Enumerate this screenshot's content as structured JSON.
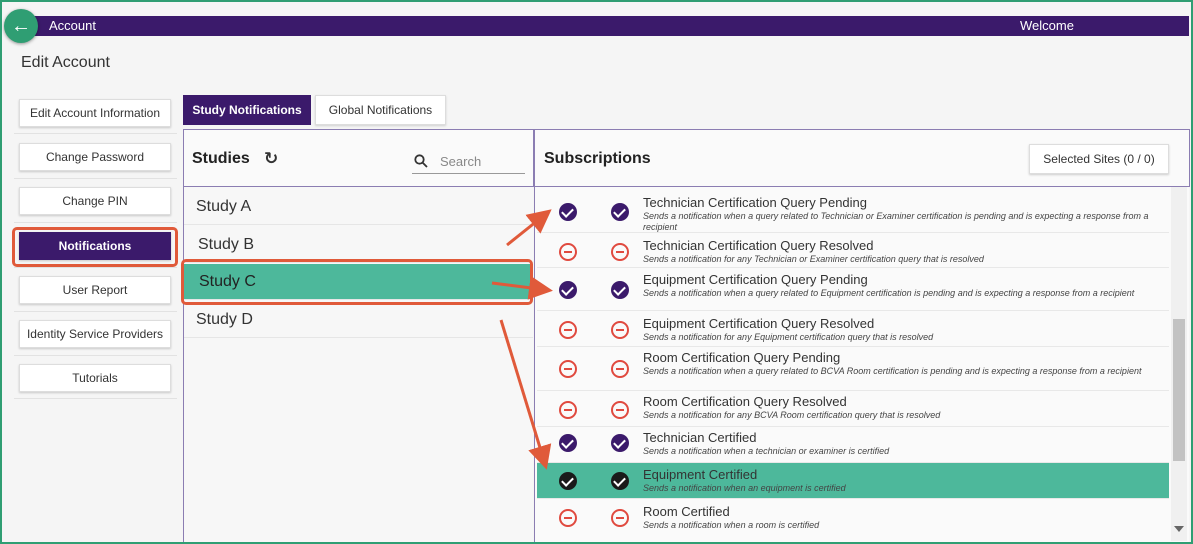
{
  "header": {
    "title": "Account",
    "welcome": "Welcome",
    "back_icon": "arrow-left-icon"
  },
  "page": {
    "title": "Edit Account"
  },
  "sidebar": {
    "items": [
      {
        "label": "Edit Account Information",
        "active": false
      },
      {
        "label": "Change Password",
        "active": false
      },
      {
        "label": "Change PIN",
        "active": false
      },
      {
        "label": "Notifications",
        "active": true
      },
      {
        "label": "User Report",
        "active": false
      },
      {
        "label": "Identity Service Providers",
        "active": false
      },
      {
        "label": "Tutorials",
        "active": false
      }
    ]
  },
  "tabs": [
    {
      "label": "Study Notifications",
      "active": true
    },
    {
      "label": "Global Notifications",
      "active": false
    }
  ],
  "studies": {
    "title": "Studies",
    "refresh_icon": "refresh-icon",
    "search": {
      "placeholder": "Search",
      "value": ""
    },
    "items": [
      {
        "label": "Study A",
        "selected": false
      },
      {
        "label": "Study B",
        "selected": false
      },
      {
        "label": "Study C",
        "selected": true
      },
      {
        "label": "Study D",
        "selected": false
      }
    ]
  },
  "subscriptions": {
    "title": "Subscriptions",
    "selected_sites_label": "Selected Sites (0 / 0)",
    "items": [
      {
        "name": "Technician Certification Query Pending",
        "description": "Sends a notification when a query related to Technician or Examiner certification is pending and is expecting a response from a recipient",
        "status1": "subscribed",
        "status2": "subscribed"
      },
      {
        "name": "Technician Certification Query Resolved",
        "description": "Sends a notification for any Technician or Examiner certification query that is resolved",
        "status1": "unsubscribed",
        "status2": "unsubscribed"
      },
      {
        "name": "Equipment Certification Query Pending",
        "description": "Sends a notification when a query related to Equipment certification is pending and is expecting a response from a recipient",
        "status1": "subscribed",
        "status2": "subscribed"
      },
      {
        "name": "Equipment Certification Query Resolved",
        "description": "Sends a notification for any Equipment certification query that is resolved",
        "status1": "unsubscribed",
        "status2": "unsubscribed"
      },
      {
        "name": "Room Certification Query Pending",
        "description": "Sends a notification when a query related to BCVA Room certification is pending and is expecting a response from a recipient",
        "status1": "unsubscribed",
        "status2": "unsubscribed"
      },
      {
        "name": "Room Certification Query Resolved",
        "description": "Sends a notification for any BCVA Room certification query that is resolved",
        "status1": "unsubscribed",
        "status2": "unsubscribed"
      },
      {
        "name": "Technician Certified",
        "description": "Sends a notification when a technician or examiner is certified",
        "status1": "subscribed",
        "status2": "subscribed"
      },
      {
        "name": "Equipment Certified",
        "description": "Sends a notification when an equipment is certified",
        "status1": "subscribed",
        "status2": "subscribed",
        "highlighted": true
      },
      {
        "name": "Room Certified",
        "description": "Sends a notification when a room is certified",
        "status1": "unsubscribed",
        "status2": "unsubscribed"
      }
    ]
  },
  "colors": {
    "brand": "#3b1a6b",
    "accent": "#2f9e73",
    "selected_row": "#4db89b",
    "annotation": "#e05a3a"
  }
}
